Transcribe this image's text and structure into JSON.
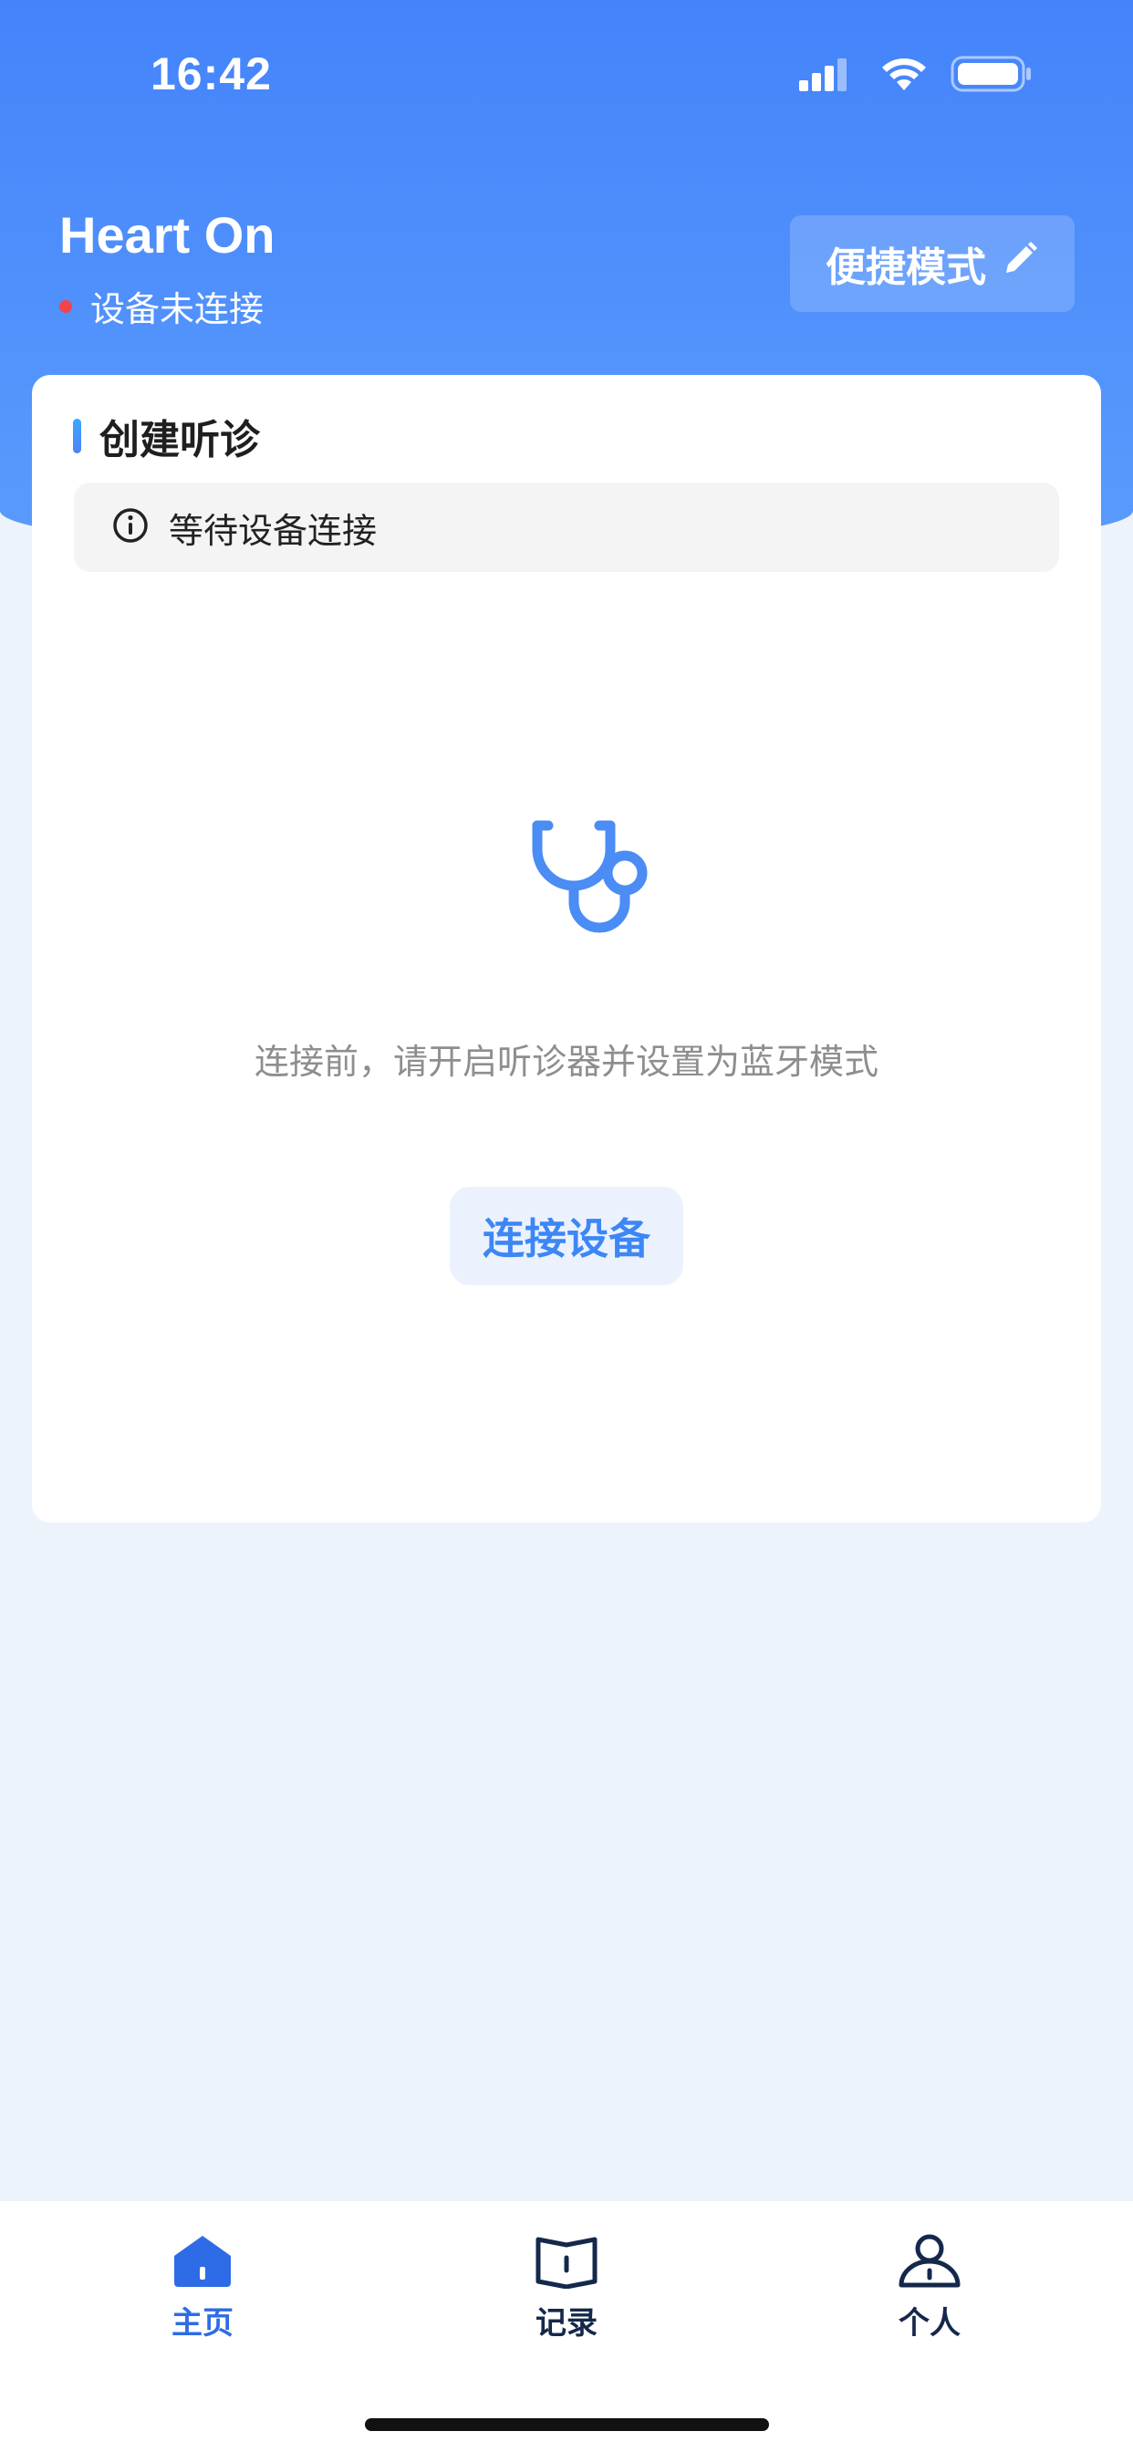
{
  "status_bar": {
    "time": "16:42",
    "icons": [
      "cellular-signal-icon",
      "wifi-icon",
      "battery-icon"
    ]
  },
  "header": {
    "app_title": "Heart On",
    "connection_status": "设备未连接",
    "connection_status_color": "#f5434a",
    "quick_mode_label": "便捷模式",
    "quick_mode_icon": "pencil-icon"
  },
  "card": {
    "title": "创建听诊",
    "notice_icon": "info-icon",
    "notice_text": "等待设备连接",
    "illustration_icon": "stethoscope-icon",
    "hint": "连接前，请开启听诊器并设置为蓝牙模式",
    "connect_button_label": "连接设备"
  },
  "tabbar": {
    "active_color": "#2e6be6",
    "inactive_color": "#14284b",
    "tabs": [
      {
        "label": "主页",
        "icon": "home-icon",
        "active": true
      },
      {
        "label": "记录",
        "icon": "book-icon",
        "active": false
      },
      {
        "label": "个人",
        "icon": "person-icon",
        "active": false
      }
    ]
  },
  "colors": {
    "primary": "#4483fb",
    "accent": "#3d86f5",
    "page_background": "#edf3fb"
  }
}
